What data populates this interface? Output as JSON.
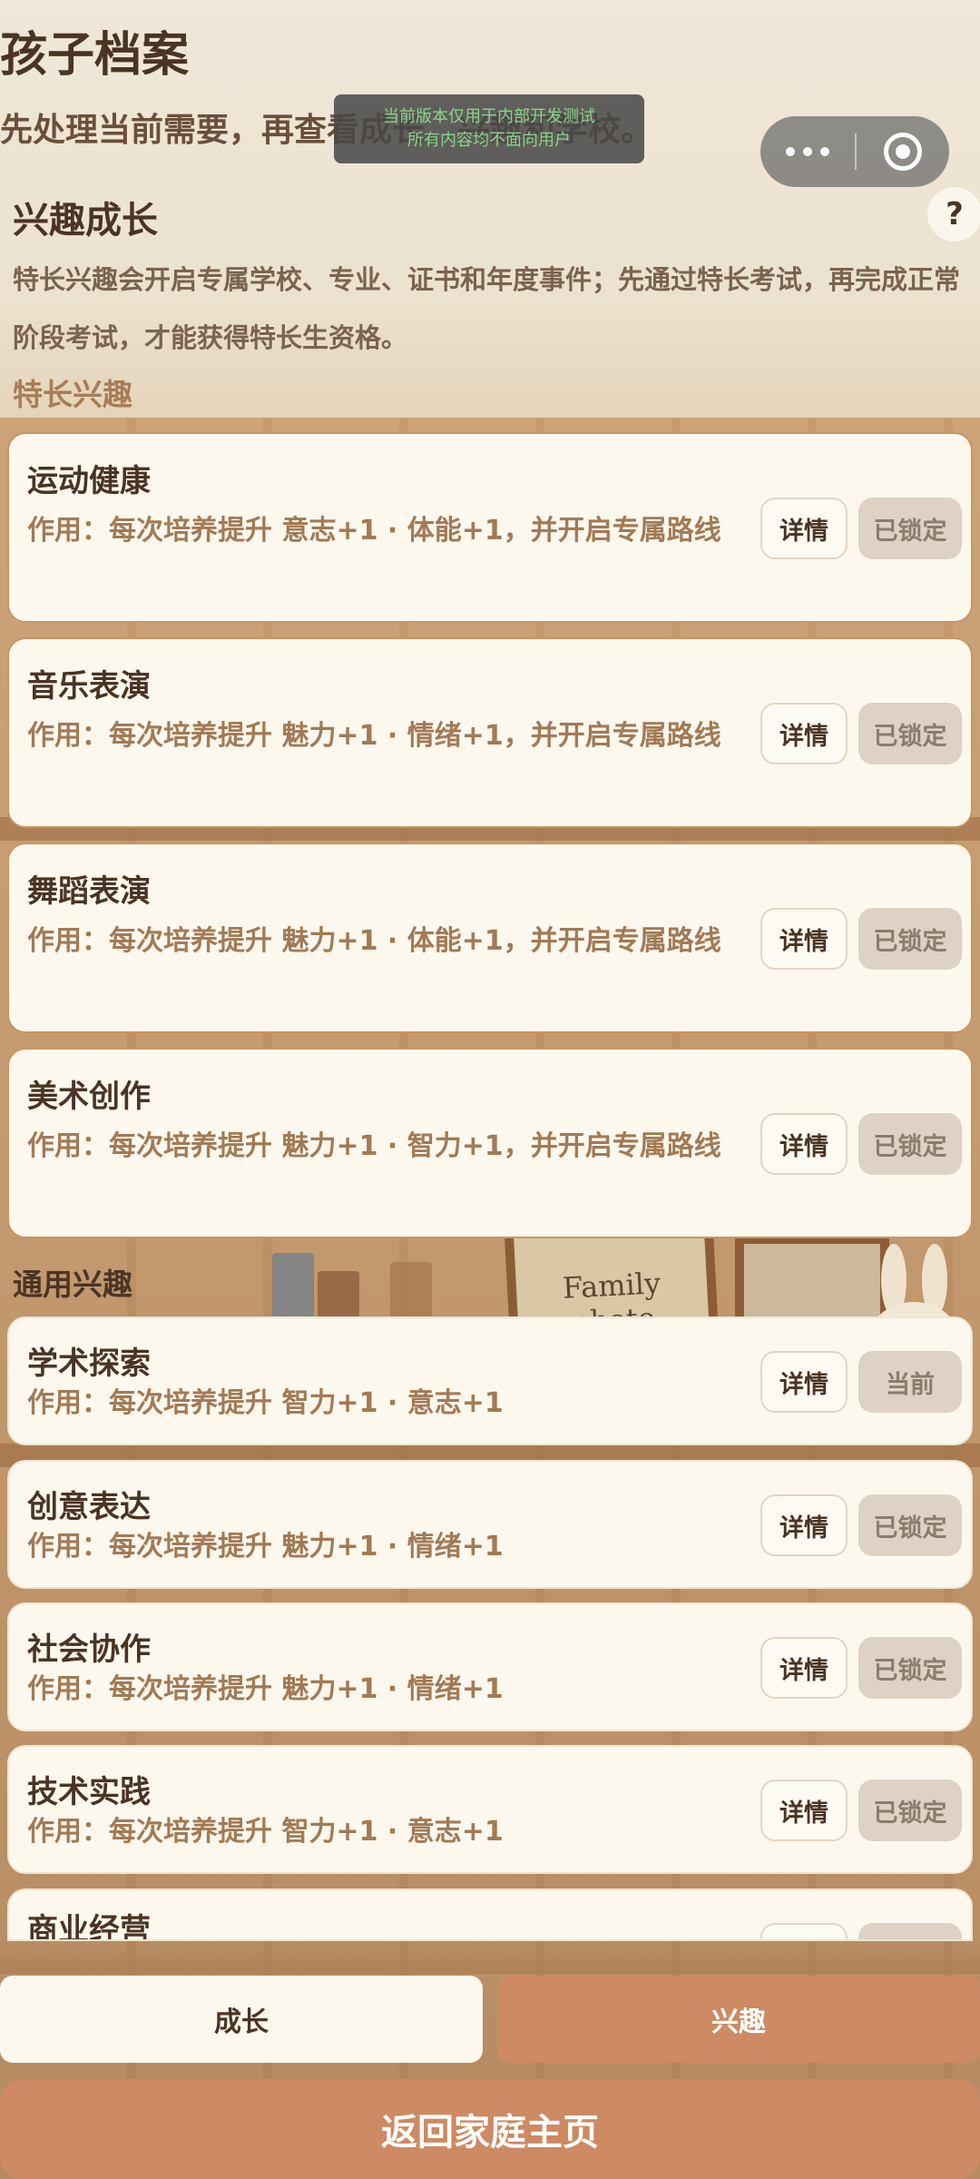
{
  "header": {
    "title": "孩子档案",
    "subtitle": "先处理当前需要，再查看成长、兴趣和学校。",
    "dev_banner_line1": "当前版本仅用于内部开发测试",
    "dev_banner_line2": "所有内容均不面向用户"
  },
  "section": {
    "title": "兴趣成长",
    "help_label": "?",
    "description": "特长兴趣会开启专属学校、专业、证书和年度事件；先通过特长考试，再完成正常阶段考试，才能获得特长生资格。"
  },
  "groups": {
    "special_label": "特长兴趣",
    "general_label": "通用兴趣"
  },
  "special_interests": [
    {
      "name": "运动健康",
      "effect": "作用：每次培养提升 意志+1 · 体能+1，并开启专属路线",
      "detail_label": "详情",
      "status_label": "已锁定"
    },
    {
      "name": "音乐表演",
      "effect": "作用：每次培养提升 魅力+1 · 情绪+1，并开启专属路线",
      "detail_label": "详情",
      "status_label": "已锁定"
    },
    {
      "name": "舞蹈表演",
      "effect": "作用：每次培养提升 魅力+1 · 体能+1，并开启专属路线",
      "detail_label": "详情",
      "status_label": "已锁定"
    },
    {
      "name": "美术创作",
      "effect": "作用：每次培养提升 魅力+1 · 智力+1，并开启专属路线",
      "detail_label": "详情",
      "status_label": "已锁定"
    }
  ],
  "general_interests": [
    {
      "name": "学术探索",
      "effect": "作用：每次培养提升 智力+1 · 意志+1",
      "detail_label": "详情",
      "status_label": "当前"
    },
    {
      "name": "创意表达",
      "effect": "作用：每次培养提升 魅力+1 · 情绪+1",
      "detail_label": "详情",
      "status_label": "已锁定"
    },
    {
      "name": "社会协作",
      "effect": "作用：每次培养提升 魅力+1 · 情绪+1",
      "detail_label": "详情",
      "status_label": "已锁定"
    },
    {
      "name": "技术实践",
      "effect": "作用：每次培养提升 智力+1 · 意志+1",
      "detail_label": "详情",
      "status_label": "已锁定"
    },
    {
      "name": "商业经营"
    }
  ],
  "background": {
    "photo_frame_text": "Family photo"
  },
  "tabs": {
    "growth_label": "成长",
    "interest_label": "兴趣"
  },
  "footer": {
    "home_button_label": "返回家庭主页"
  }
}
